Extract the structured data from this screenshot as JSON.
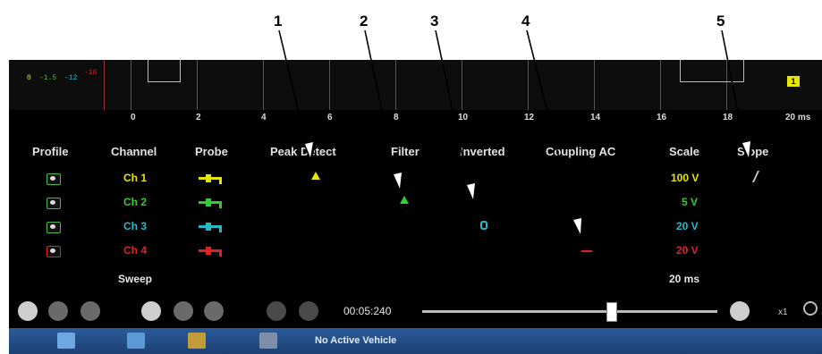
{
  "callouts": [
    "1",
    "2",
    "3",
    "4",
    "5"
  ],
  "scale_readouts": [
    {
      "text": "0",
      "color": "#e6e600"
    },
    {
      "text": "-1.5",
      "color": "#33cc33"
    },
    {
      "text": "-12",
      "color": "#22bbcc"
    },
    {
      "text": "-16",
      "color": "#dd2222"
    }
  ],
  "time_axis": [
    "0",
    "2",
    "4",
    "6",
    "8",
    "10",
    "12",
    "14",
    "16",
    "18",
    "20 ms"
  ],
  "channel_marker": "1",
  "columns": [
    "Profile",
    "Channel",
    "Probe",
    "Peak Detect",
    "Filter",
    "Inverted",
    "Coupling AC",
    "Scale",
    "Slope"
  ],
  "channels": [
    {
      "name": "Ch 1",
      "color": "#e6e600",
      "scale": "100 V"
    },
    {
      "name": "Ch 2",
      "color": "#33cc33",
      "scale": "5 V"
    },
    {
      "name": "Ch 3",
      "color": "#22bbcc",
      "scale": "20 V"
    },
    {
      "name": "Ch 4",
      "color": "#dd2222",
      "scale": "20 V"
    }
  ],
  "sweep": {
    "label": "Sweep",
    "value": "20 ms"
  },
  "playback": {
    "time": "00:05:240",
    "zoom": "x1",
    "position": 0.64
  },
  "taskbar": {
    "status": "No Active Vehicle"
  },
  "icons": {
    "home": "home-icon",
    "search": "magnifier-icon",
    "eye": "eye-icon"
  }
}
